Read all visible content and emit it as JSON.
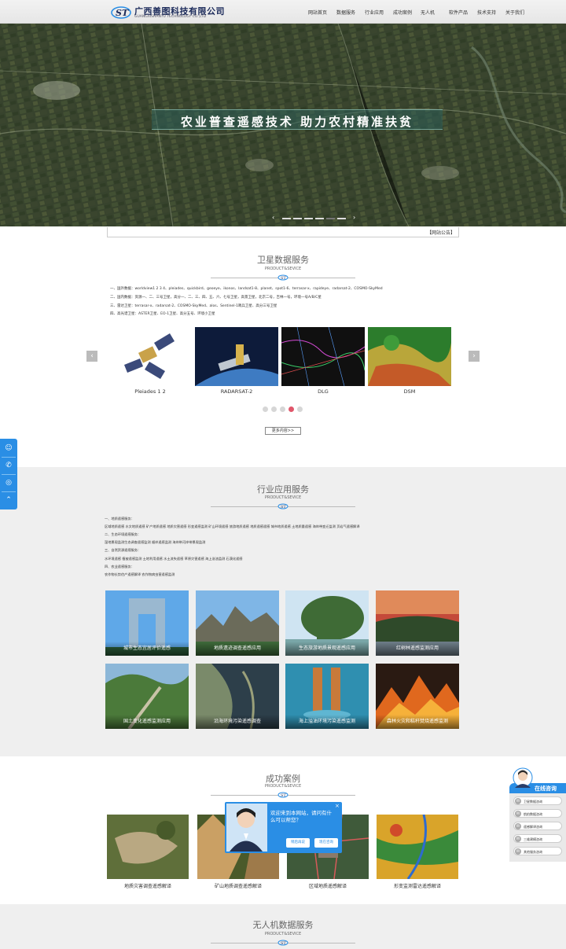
{
  "header": {
    "logo_cn": "广西善图科技有限公司",
    "logo_en": "GUANGXISHANTU TECHNOLOGY CO.,LTD",
    "nav": [
      "网站首页",
      "数据服务",
      "行业应用",
      "成功案例",
      "无人机",
      "软件产品",
      "技术支持",
      "关于我们"
    ]
  },
  "banner": {
    "title": "农业普查遥感技术  助力农村精准扶贫",
    "prev": "‹",
    "next": "›"
  },
  "notice": {
    "label": "【网站公告】"
  },
  "sat": {
    "title": "卫星数据服务",
    "sub": "PRODUCT&SEVICE",
    "lines": [
      "一、国外数据：worldview1 2 3 4、pleiades、quickbird、geoeye、ikonos、landsat1-8、planet、spot1-6、terrasar-x、rapideye、radarsat-2、COSMO-SkyMed",
      "二、国内数据：资源一、二、三号卫星，高分一、二、三、四、五、六、七号卫星，高景卫星，北京二号，吉林一号，环境一号A/B/C星",
      "三、雷达卫星：terrasar-x、radarsat-2、COSMO-SkyMed、alos、Sentinel-1哨兵卫星、高分三号卫星",
      "四、高光谱卫星：ASTER卫星、EO-1卫星、高分五号、环境小卫星"
    ],
    "cards": [
      "Pleiades 1 2",
      "RADARSAT-2",
      "DLG",
      "DSM"
    ],
    "prev": "‹",
    "next": "›",
    "more": "更多内容>>"
  },
  "ind": {
    "title": "行业应用服务",
    "sub": "PRODUCT&SEVICE",
    "lines": [
      "一、地质遥感服务：",
      "区域地质遥感 水文地质遥感 矿产地质遥感 地质灾害遥感 形变遥感监测 矿山环境遥感 旅游地质遥感 地质遥感遥感 城市地质遥感 土地质量遥感 海岸带变迁监测 页岩气遥感解译",
      "二、生态环境遥感服务：",
      "湿地景观监测生态调查遥感监测 顺岸遥感监测 海岸带河岸带景观监测",
      "三、自然资源遥感服务：",
      "水环境遥感 植被遥感监测 土地利用遥感 水土流失遥感 草原灾害遥感 海上溢油监测 石漠化遥感",
      "四、农业遥感服务：",
      "农作物长势估产遥感解译 农作物病虫害遥感监测"
    ],
    "cards": [
      "城市生态宜居评价遥感",
      "地质遗迹调查遥感应用",
      "生态旅游地质景观遥感应用",
      "红树林遥感监测应用",
      "国土变化遥感监测应用",
      "沿海环境污染遥感调查",
      "海上溢油环境污染遥感监测",
      "森林火灾和秸秆焚烧遥感监测"
    ]
  },
  "cases": {
    "title": "成功案例",
    "sub": "PRODUCT&SEVICE",
    "cards": [
      "地质灾害调查遥感解译",
      "矿山地质调查遥感解译",
      "区域地质遥感解译",
      "形变监测雷达遥感解译"
    ]
  },
  "uav": {
    "title": "无人机数据服务",
    "sub": "PRODUCT&SEVICE"
  },
  "side": {
    "icons": [
      "qq-icon",
      "phone-icon",
      "wechat-icon",
      "top-icon"
    ]
  },
  "cs": {
    "title": "在线咨询",
    "items": [
      "卫星数据咨询",
      "航拍数据咨询",
      "遥感解译咨询",
      "三维建模咨询",
      "其他服务咨询"
    ]
  },
  "popup": {
    "msg": "欢迎来到本网站，请问有什么可以帮您？",
    "later": "稍后再说",
    "now": "现在咨询",
    "close": "×"
  },
  "colors": {
    "accent": "#2a8ee5",
    "gray_band": "#efefef"
  }
}
